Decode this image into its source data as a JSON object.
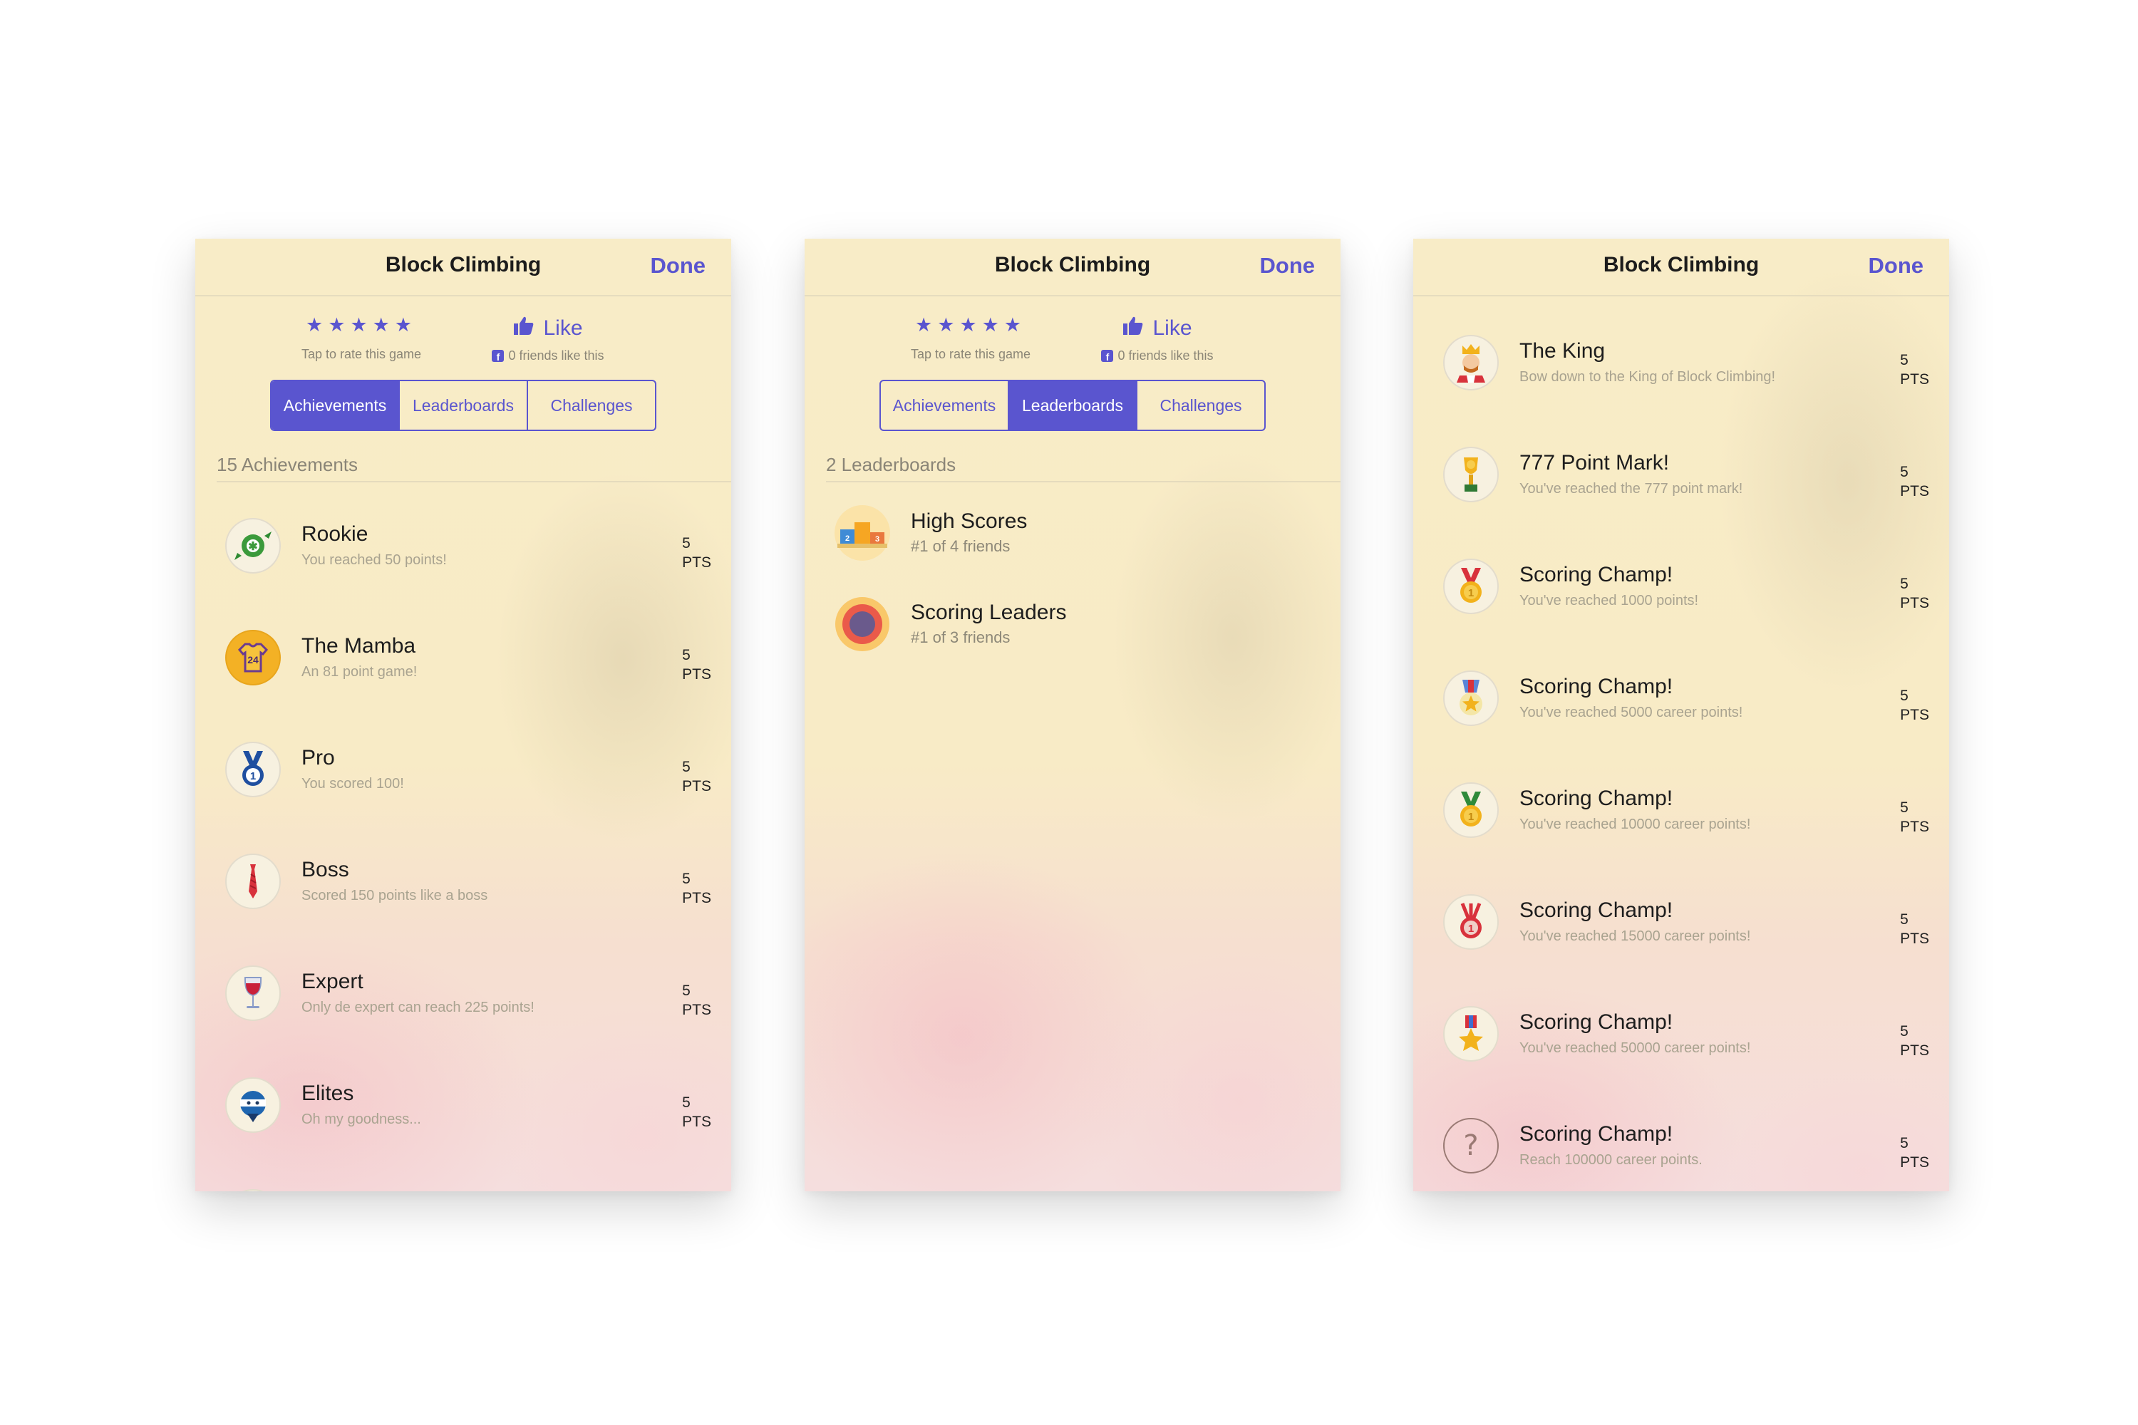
{
  "app": {
    "title": "Block Climbing",
    "done_label": "Done",
    "rating_stars": "★★★★★",
    "rate_hint": "Tap to rate this game",
    "like_label": "Like",
    "friends_like": "0 friends like this",
    "tabs": [
      "Achievements",
      "Leaderboards",
      "Challenges"
    ],
    "accent_color": "#5a55cf"
  },
  "screens": {
    "achievements": {
      "active_tab": "Achievements",
      "header": "15 Achievements",
      "items": [
        {
          "title": "Rookie",
          "subtitle": "You reached 50 points!",
          "points": "5",
          "unit": "PTS",
          "icon": "candy-icon"
        },
        {
          "title": "The Mamba",
          "subtitle": "An 81 point game!",
          "points": "5",
          "unit": "PTS",
          "icon": "jersey-icon"
        },
        {
          "title": "Pro",
          "subtitle": "You scored 100!",
          "points": "5",
          "unit": "PTS",
          "icon": "medal-icon"
        },
        {
          "title": "Boss",
          "subtitle": "Scored 150 points like a boss",
          "points": "5",
          "unit": "PTS",
          "icon": "tie-icon"
        },
        {
          "title": "Expert",
          "subtitle": "Only de expert can reach 225 points!",
          "points": "5",
          "unit": "PTS",
          "icon": "wine-glass-icon"
        },
        {
          "title": "Elites",
          "subtitle": "Oh my goodness...",
          "points": "5",
          "unit": "PTS",
          "icon": "ninja-icon"
        }
      ]
    },
    "leaderboards": {
      "active_tab": "Leaderboards",
      "header": "2 Leaderboards",
      "items": [
        {
          "title": "High Scores",
          "subtitle": "#1 of 4 friends",
          "icon": "podium-icon"
        },
        {
          "title": "Scoring Leaders",
          "subtitle": "#1 of 3 friends",
          "icon": "target-icon"
        }
      ]
    },
    "achievements_more": {
      "items": [
        {
          "title": "The King",
          "subtitle": "Bow down to the King of Block Climbing!",
          "points": "5",
          "unit": "PTS",
          "icon": "king-icon"
        },
        {
          "title": "777 Point Mark!",
          "subtitle": "You've reached the 777 point mark!",
          "points": "5",
          "unit": "PTS",
          "icon": "trophy-icon"
        },
        {
          "title": "Scoring Champ!",
          "subtitle": "You've reached 1000 points!",
          "points": "5",
          "unit": "PTS",
          "icon": "gold-medal-icon"
        },
        {
          "title": "Scoring Champ!",
          "subtitle": "You've reached 5000 career points!",
          "points": "5",
          "unit": "PTS",
          "icon": "star-medal-icon"
        },
        {
          "title": "Scoring Champ!",
          "subtitle": "You've reached 10000 career points!",
          "points": "5",
          "unit": "PTS",
          "icon": "green-medal-icon"
        },
        {
          "title": "Scoring Champ!",
          "subtitle": "You've reached 15000 career points!",
          "points": "5",
          "unit": "PTS",
          "icon": "red-medal-icon"
        },
        {
          "title": "Scoring Champ!",
          "subtitle": "You've reached 50000 career points!",
          "points": "5",
          "unit": "PTS",
          "icon": "star-ribbon-icon"
        },
        {
          "title": "Scoring Champ!",
          "subtitle": "Reach 100000 career points.",
          "points": "5",
          "unit": "PTS",
          "icon": "question-icon"
        }
      ]
    }
  }
}
